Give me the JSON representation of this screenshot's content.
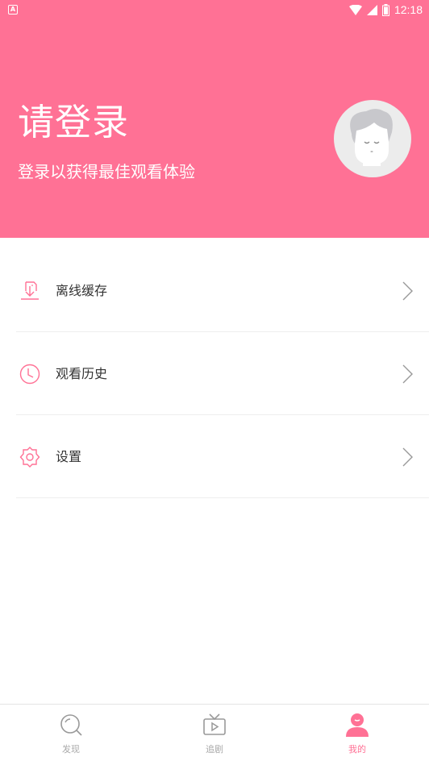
{
  "status_bar": {
    "time": "12:18"
  },
  "header": {
    "title": "请登录",
    "subtitle": "登录以获得最佳观看体验"
  },
  "menu": [
    {
      "label": "离线缓存",
      "icon": "download-icon"
    },
    {
      "label": "观看历史",
      "icon": "clock-icon"
    },
    {
      "label": "设置",
      "icon": "gear-icon"
    }
  ],
  "tabs": [
    {
      "label": "发现",
      "icon": "search-icon",
      "active": false
    },
    {
      "label": "追剧",
      "icon": "tv-icon",
      "active": false
    },
    {
      "label": "我的",
      "icon": "user-icon",
      "active": true
    }
  ],
  "colors": {
    "accent": "#ff7195",
    "icon_gray": "#999999",
    "divider": "#eeeeee"
  }
}
